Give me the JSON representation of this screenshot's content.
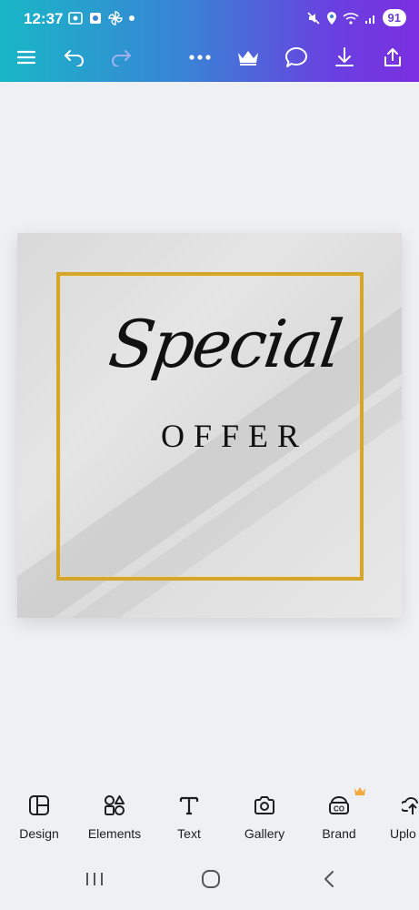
{
  "status": {
    "time": "12:37",
    "battery": "91"
  },
  "toolbar": {
    "menu": "menu-icon",
    "undo": "undo-icon",
    "redo": "redo-icon",
    "more": "more-icon",
    "premium": "crown-icon",
    "comment": "comment-icon",
    "download": "download-icon",
    "share": "share-icon"
  },
  "design": {
    "script_text": "Special",
    "caps_text": "OFFER",
    "frame_color": "#d4a72c"
  },
  "nav": {
    "items": [
      {
        "label": "Design",
        "icon": "design-icon"
      },
      {
        "label": "Elements",
        "icon": "elements-icon"
      },
      {
        "label": "Text",
        "icon": "text-icon"
      },
      {
        "label": "Gallery",
        "icon": "camera-icon"
      },
      {
        "label": "Brand",
        "icon": "brand-icon"
      },
      {
        "label": "Uplo",
        "icon": "upload-icon"
      }
    ]
  }
}
